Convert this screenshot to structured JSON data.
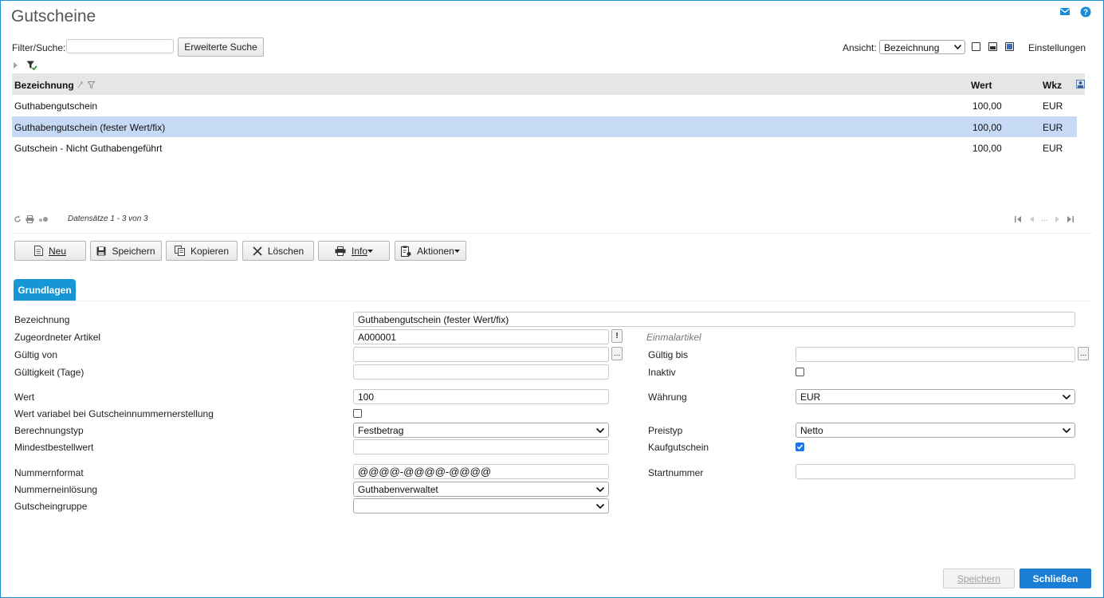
{
  "page": {
    "title": "Gutscheine"
  },
  "toolbar": {
    "filter_label": "Filter/Suche:",
    "filter_value": "",
    "advanced_search_label": "Erweiterte Suche",
    "view_label": "Ansicht:",
    "view_selected": "Bezeichnung",
    "settings_label": "Einstellungen"
  },
  "grid": {
    "headers": {
      "name": "Bezeichnung",
      "value": "Wert",
      "currency": "Wkz"
    },
    "rows": [
      {
        "name": "Guthabengutschein",
        "value": "100,00",
        "currency": "EUR",
        "selected": false
      },
      {
        "name": "Guthabengutschein (fester Wert/fix)",
        "value": "100,00",
        "currency": "EUR",
        "selected": true
      },
      {
        "name": "Gutschein - Nicht Guthabengeführt",
        "value": "100,00",
        "currency": "EUR",
        "selected": false
      }
    ],
    "records_text": "Datensätze 1 - 3 von 3",
    "pager_ellipsis": "..."
  },
  "actions": {
    "new": "Neu",
    "save": "Speichern",
    "copy": "Kopieren",
    "delete": "Löschen",
    "info": "Info",
    "actions": "Aktionen"
  },
  "tabs": {
    "basics": "Grundlagen"
  },
  "form": {
    "name_label": "Bezeichnung",
    "name_value": "Guthabengutschein (fester Wert/fix)",
    "article_label": "Zugeordneter Artikel",
    "article_value": "A000001",
    "article_btn": "!",
    "article_hint": "Einmalartikel",
    "valid_from_label": "Gültig von",
    "valid_from_value": "",
    "dots_btn": "...",
    "valid_to_label": "Gültig bis",
    "valid_to_value": "",
    "validity_days_label": "Gültigkeit (Tage)",
    "validity_days_value": "",
    "inactive_label": "Inaktiv",
    "inactive_checked": false,
    "value_label": "Wert",
    "value_value": "100",
    "currency_label": "Währung",
    "currency_value": "EUR",
    "variable_value_label": "Wert variabel bei Gutscheinnummernerstellung",
    "variable_value_checked": false,
    "calc_type_label": "Berechnungstyp",
    "calc_type_value": "Festbetrag",
    "price_type_label": "Preistyp",
    "price_type_value": "Netto",
    "min_order_label": "Mindestbestellwert",
    "min_order_value": "",
    "purchase_voucher_label": "Kaufgutschein",
    "purchase_voucher_checked": true,
    "number_format_label": "Nummernformat",
    "number_format_value": "@@@@-@@@@-@@@@",
    "start_number_label": "Startnummer",
    "start_number_value": "",
    "redemption_label": "Nummerneinlösung",
    "redemption_value": "Guthabenverwaltet",
    "group_label": "Gutscheingruppe",
    "group_value": ""
  },
  "footer": {
    "save": "Speichern",
    "close": "Schließen"
  },
  "colors": {
    "accent": "#1796d6",
    "selected_row": "#c6d9f5",
    "primary_button": "#1a7fd4"
  }
}
